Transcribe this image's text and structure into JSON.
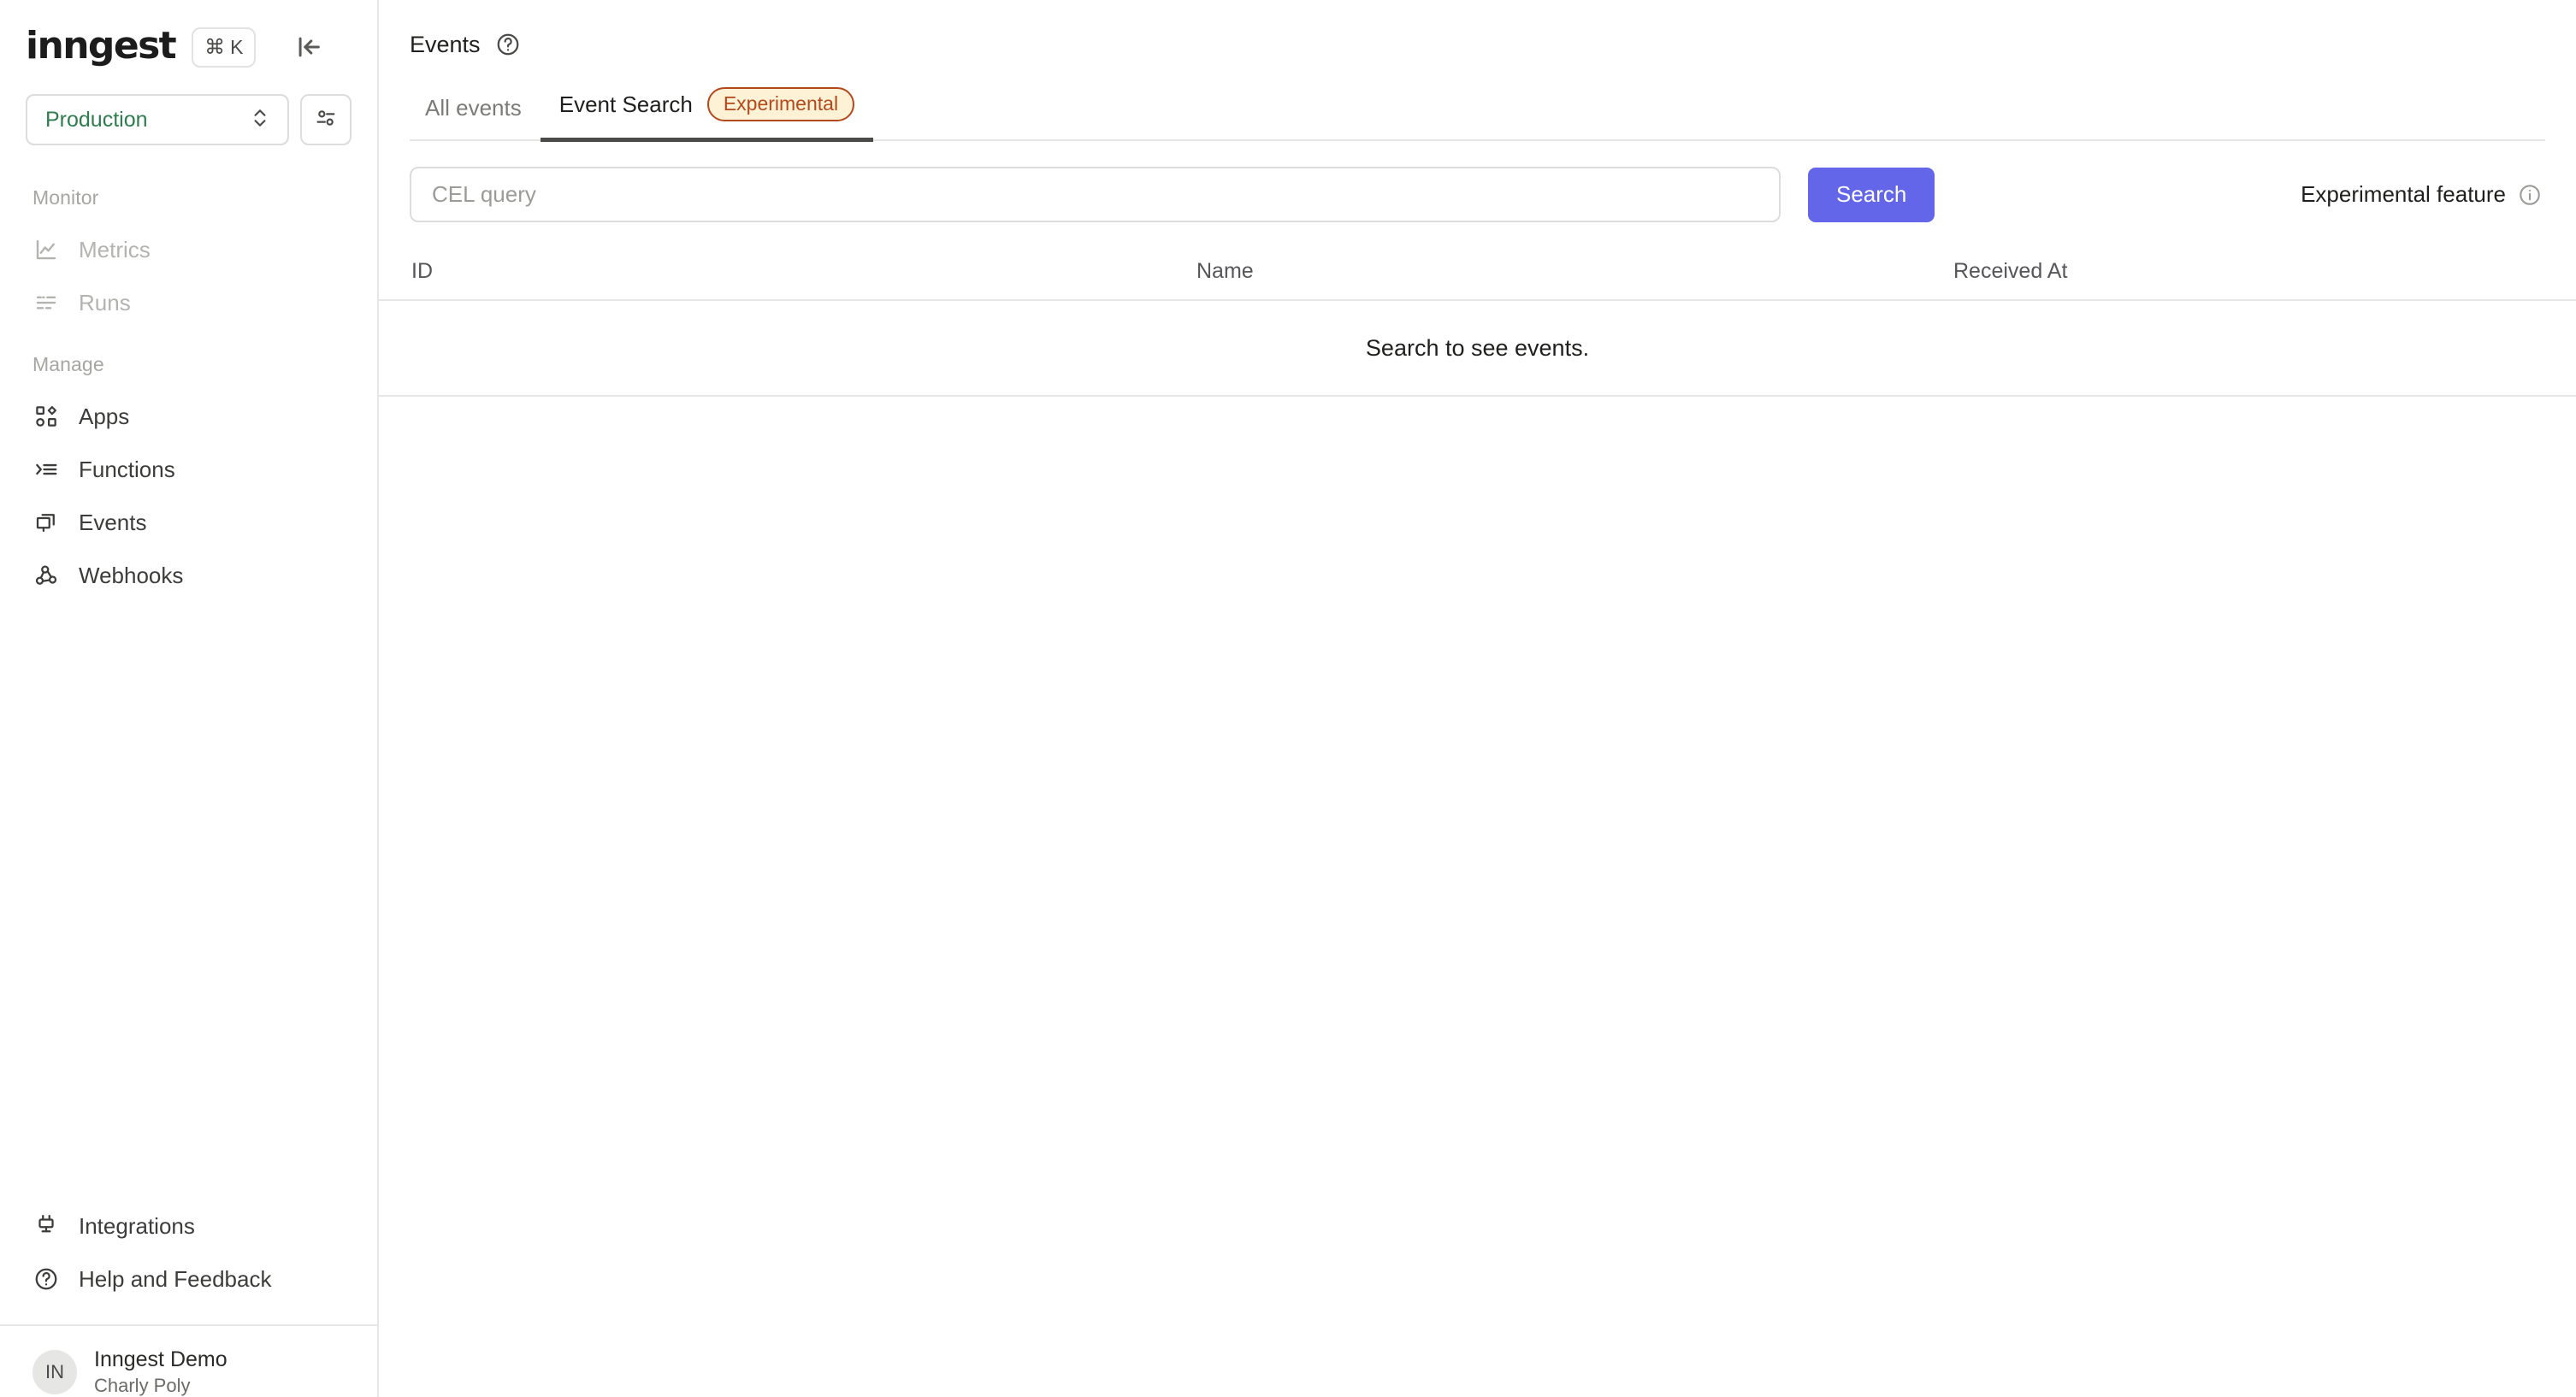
{
  "sidebar": {
    "brand": "inngest",
    "shortcut": {
      "cmd": "⌘",
      "key": "K"
    },
    "collapse_icon": "collapse-panel-icon",
    "environment": {
      "label": "Production",
      "chevron_icon": "chevron-up-down-icon"
    },
    "env_filter_icon": "sliders-icon",
    "sections": [
      {
        "label": "Monitor",
        "items": [
          {
            "label": "Metrics",
            "icon": "chart-line-icon",
            "muted": true
          },
          {
            "label": "Runs",
            "icon": "list-runs-icon",
            "muted": true
          }
        ]
      },
      {
        "label": "Manage",
        "items": [
          {
            "label": "Apps",
            "icon": "apps-shapes-icon",
            "muted": false
          },
          {
            "label": "Functions",
            "icon": "functions-list-icon",
            "muted": false
          },
          {
            "label": "Events",
            "icon": "events-windows-icon",
            "muted": false
          },
          {
            "label": "Webhooks",
            "icon": "webhook-icon",
            "muted": false
          }
        ]
      }
    ],
    "footer_items": [
      {
        "label": "Integrations",
        "icon": "plug-icon"
      },
      {
        "label": "Help and Feedback",
        "icon": "question-circle-icon"
      }
    ],
    "user": {
      "avatar_initials": "IN",
      "name": "Inngest Demo",
      "org": "Charly Poly"
    }
  },
  "main": {
    "page_title": "Events",
    "help_icon": "question-circle-icon",
    "tabs": [
      {
        "label": "All events",
        "active": false,
        "badge": null
      },
      {
        "label": "Event Search",
        "active": true,
        "badge": "Experimental"
      }
    ],
    "search": {
      "placeholder": "CEL query",
      "value": "",
      "button_label": "Search"
    },
    "experimental_notice": {
      "label": "Experimental feature",
      "icon": "info-circle-icon"
    },
    "table": {
      "columns": [
        "ID",
        "Name",
        "Received At"
      ],
      "rows": [],
      "empty_message": "Search to see events."
    }
  },
  "colors": {
    "accent_primary": "#6366e8",
    "env_green": "#2f7d4f",
    "badge_bg": "#fdf2d6",
    "badge_border": "#b5481b",
    "badge_text": "#b5481b",
    "border": "#e6e6e4",
    "text_primary": "#1f1f1d",
    "text_muted": "#b3b3b0"
  }
}
